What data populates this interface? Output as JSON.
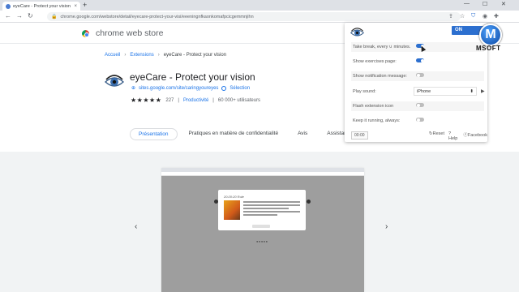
{
  "browser": {
    "tab_title": "eyeCare - Protect your vision - C",
    "tab_close": "×",
    "new_tab": "+",
    "url": "chrome.google.com/webstore/detail/eyecare-protect-your-visi/eeeningnfkaonkomafpcicgemmnjihn",
    "minimize": "—",
    "maximize": "☐",
    "close": "✕"
  },
  "store": {
    "name": "chrome web store"
  },
  "breadcrumb": {
    "home": "Accueil",
    "section": "Extensions",
    "current": "eyeCare - Protect your vision",
    "sep": "›"
  },
  "extension": {
    "title": "eyeCare - Protect your vision",
    "site": "sites.google.com/site/caringyoureyes",
    "badge": "Sélection",
    "stars": "★★★★★",
    "rating_count": "227",
    "category": "Productivité",
    "users": "60 000+ utilisateurs",
    "divider": "|"
  },
  "page_tabs": [
    "Présentation",
    "Pratiques en matière de confidentialité",
    "Avis",
    "Assistance"
  ],
  "carousel": {
    "prev": "‹",
    "next": "›",
    "shot_title": "20:20:20 Rule",
    "dots": "●●●●●"
  },
  "popup": {
    "power": "ON",
    "rows": [
      {
        "label": "Take break, every ∪ minutes.",
        "control": "switch",
        "on": true
      },
      {
        "label": "Show exercises page:",
        "control": "switch",
        "on": true
      },
      {
        "label": "Show notification message:",
        "control": "switch",
        "on": false
      },
      {
        "label": "Play sound:",
        "control": "select",
        "value": "iPhone"
      },
      {
        "label": "Flash extension icon",
        "control": "switch",
        "on": false
      },
      {
        "label": "Keep it running, always:",
        "control": "switch",
        "on": false
      }
    ],
    "select_arrow": "⬍",
    "play_icon": "▶",
    "time_button": "00:00",
    "footer_reset": "↻Reset",
    "footer_help": "?Help",
    "footer_facebook": "ⓕFacebook"
  },
  "watermark": {
    "letter": "M",
    "text": "MSOFT"
  },
  "colors": {
    "accent": "#1a73e8",
    "toggle_on": "#2c6fcf"
  }
}
